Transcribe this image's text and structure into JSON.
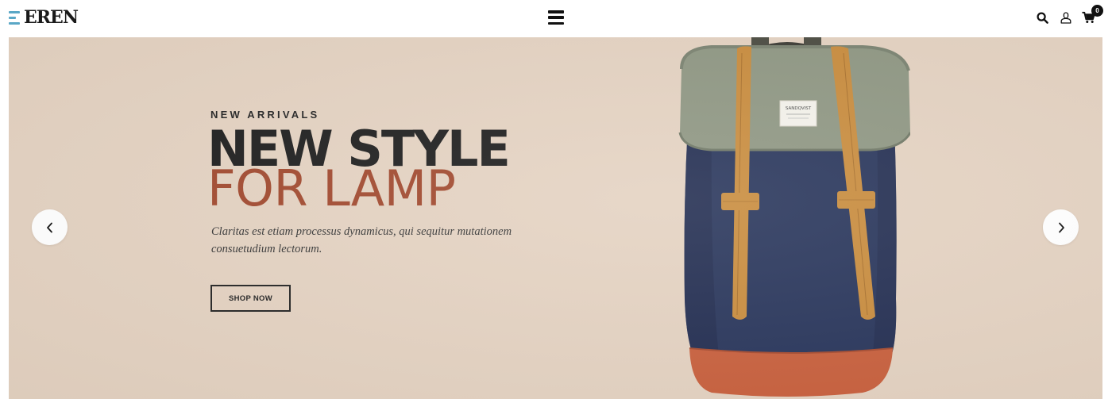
{
  "header": {
    "logo_text": "EREN",
    "icons": {
      "menu": "hamburger-menu-icon",
      "search": "search-icon",
      "account": "user-icon",
      "cart": "cart-icon"
    },
    "cart_count": "0"
  },
  "hero": {
    "eyebrow": "NEW ARRIVALS",
    "headline_line1": "NEW STYLE",
    "headline_line2": "FOR LAMP",
    "description": "Claritas est etiam processus dynamicus, qui sequitur mutationem consuetudium lectorum.",
    "button_label": "SHOP NOW",
    "product_label": "SANDQVIST",
    "prev_icon": "chevron-left-icon",
    "next_icon": "chevron-right-icon"
  },
  "colors": {
    "hero_background": "#e4d2c1",
    "headline_dark": "#1c1c1c",
    "headline_accent": "#a0472c",
    "logo_accent": "#5aa7c6"
  }
}
